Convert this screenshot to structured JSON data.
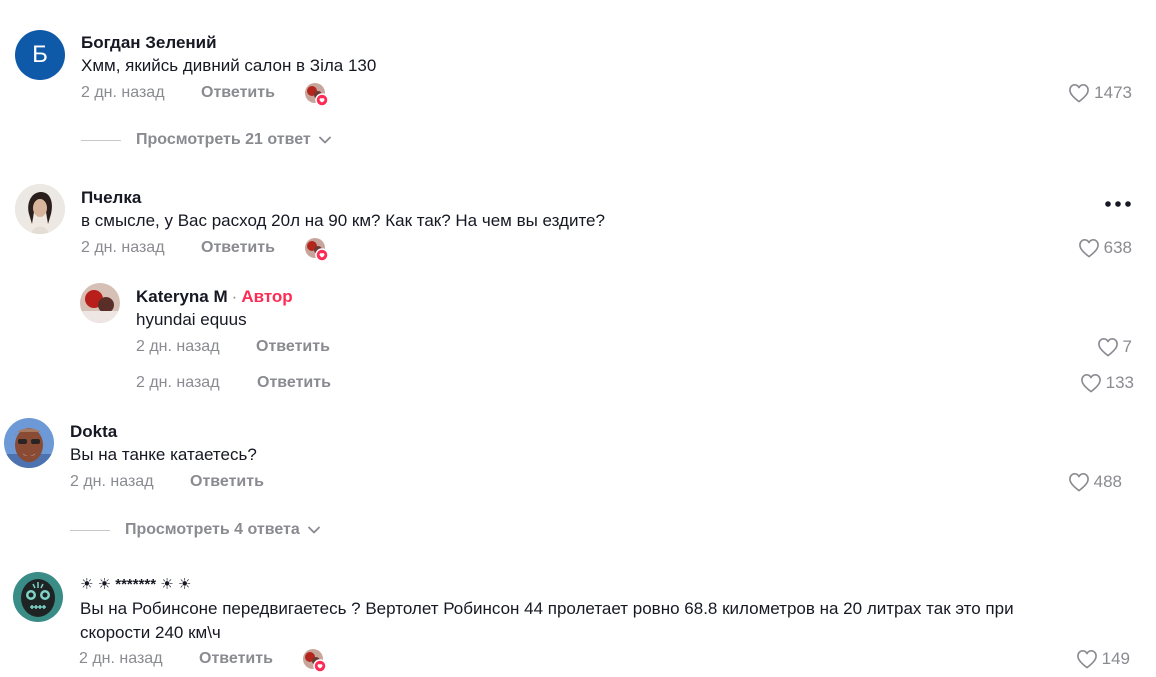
{
  "colors": {
    "text_primary": "#161823",
    "text_secondary": "#8a8b91",
    "author_accent": "#fe2c55",
    "avatar_blue": "#0f5aa8"
  },
  "icons": {
    "like": "heart-outline-icon",
    "more": "more-horizontal-icon",
    "chevron": "chevron-down-icon"
  },
  "comments": [
    {
      "avatar_letter": "Б",
      "name": "Богдан Зелений",
      "text": "Хмм, якийсь дивний салон в Зіла 130",
      "time": "2 дн. назад",
      "reply_label": "Ответить",
      "likes": "1473",
      "view_replies": "Просмотреть 21 ответ"
    },
    {
      "name": "Пчелка",
      "text": "в смысле, у Вас расход 20л на 90 км? Как так? На чем вы ездите?",
      "time": "2 дн. назад",
      "reply_label": "Ответить",
      "likes": "638",
      "reply": {
        "name": "Kateryna M",
        "separator": "·",
        "author_badge": "Автор",
        "text": "hyundai equus",
        "time": "2 дн. назад",
        "reply_label": "Ответить",
        "likes": "7"
      },
      "extra_row": {
        "time": "2 дн. назад",
        "reply_label": "Ответить",
        "likes": "133"
      }
    },
    {
      "name": "Dokta",
      "text": "Вы на танке катаетесь?",
      "time": "2 дн. назад",
      "reply_label": "Ответить",
      "likes": "488",
      "view_replies": "Просмотреть 4 ответа"
    },
    {
      "name": "☀ ☀ ******* ☀ ☀",
      "text": "Вы на Робинсоне передвигаетесь ? Вертолет Робинсон 44 пролетает ровно 68.8 километров на 20 литрах так это при скорости 240 км\\ч",
      "time": "2 дн. назад",
      "reply_label": "Ответить",
      "likes": "149"
    }
  ]
}
